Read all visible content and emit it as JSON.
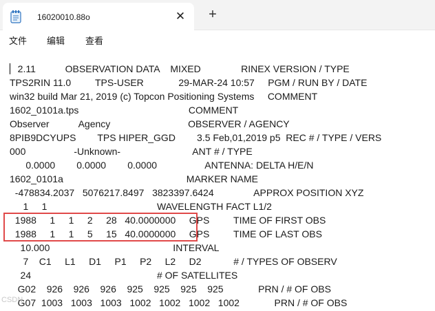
{
  "window": {
    "tab_title": "16020010.88o",
    "tab_icon": "notepad-icon",
    "close_icon": "close-icon",
    "new_tab_icon": "plus-icon"
  },
  "menu": {
    "file": "文件",
    "edit": "编辑",
    "view": "查看"
  },
  "editor": {
    "lines": [
      "   2.11           OBSERVATION DATA    MIXED               RINEX VERSION / TYPE",
      "TPS2RIN 11.0         TPS-USER             29-MAR-24 10:57     PGM / RUN BY / DATE",
      "win32 build Mar 21, 2019 (c) Topcon Positioning Systems     COMMENT",
      "1602_0101a.tps                                         COMMENT",
      "Observer           Agency                             OBSERVER / AGENCY",
      "8PIB9DCYUPS        TPS HIPER_GGD        3.5 Feb,01,2019 p5  REC # / TYPE / VERS",
      "000                  -Unknown-                           ANT # / TYPE",
      "      0.0000        0.0000        0.0000                  ANTENNA: DELTA H/E/N",
      "1602_0101a                                              MARKER NAME",
      "  -478834.2037   5076217.8497   3823397.6424               APPROX POSITION XYZ",
      "     1     1                                         WAVELENGTH FACT L1/2",
      "  1988     1     1     2     28   40.0000000     GPS         TIME OF FIRST OBS",
      "  1988     1     1     5     15   40.0000000     GPS         TIME OF LAST OBS",
      "    10.000                                              INTERVAL",
      "     7    C1     L1     D1     P1     P2     L2     D2            # / TYPES OF OBSERV",
      "    24                                               # OF SATELLITES",
      "   G02    926    926    926    925    925    925    925             PRN / # OF OBS",
      "   G07  1003   1003   1003   1002   1002   1002   1002             PRN / # OF OBS"
    ]
  },
  "watermark": "CSDN",
  "colors": {
    "highlight_border": "#e04848",
    "tabbar_bg": "#f3f3f3"
  }
}
